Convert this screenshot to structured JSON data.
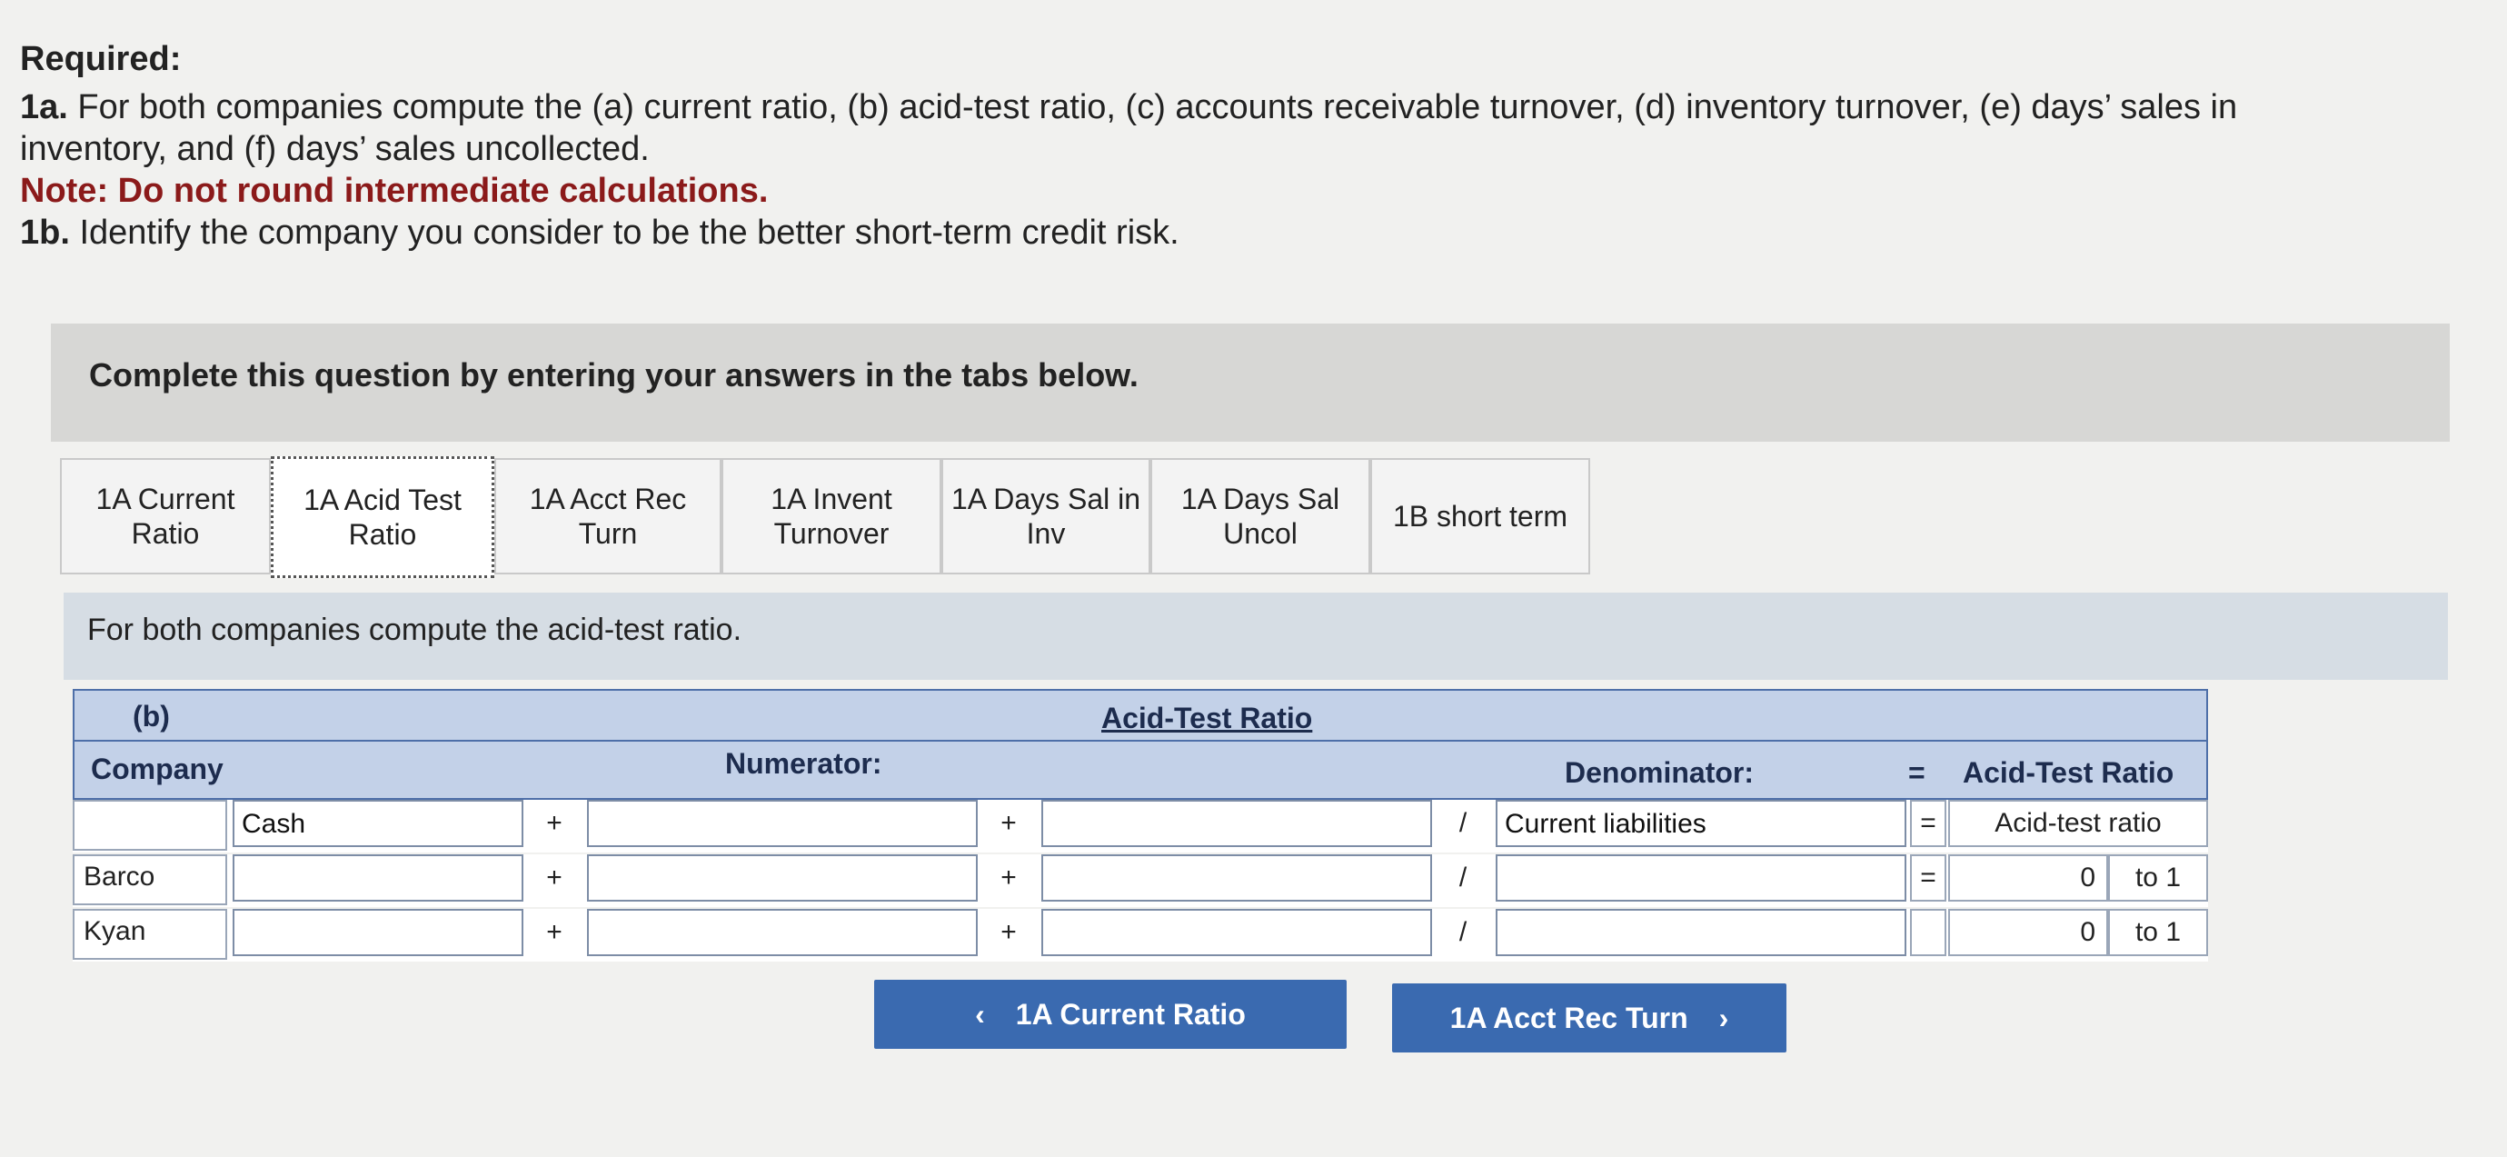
{
  "required": {
    "title": "Required:",
    "line1a_prefix": "1a.",
    "line1a_text": "For both companies compute the (a) current ratio, (b) acid-test ratio, (c) accounts receivable turnover, (d) inventory turnover, (e) days’ sales in inventory, and (f) days’ sales uncollected.",
    "note": "Note: Do not round intermediate calculations.",
    "line1b_prefix": "1b.",
    "line1b_text": "Identify the company you consider to be the better short-term credit risk."
  },
  "band": {
    "text": "Complete this question by entering your answers in the tabs below."
  },
  "tabs": [
    {
      "label": "1A Current\nRatio"
    },
    {
      "label": "1A Acid Test\nRatio"
    },
    {
      "label": "1A Acct Rec\nTurn"
    },
    {
      "label": "1A Invent\nTurnover"
    },
    {
      "label": "1A Days Sal in\nInv"
    },
    {
      "label": "1A Days Sal\nUncol"
    },
    {
      "label": "1B short term"
    }
  ],
  "instruction": "For both companies compute the acid-test ratio.",
  "table": {
    "part": "(b)",
    "title": "Acid-Test Ratio",
    "company_header": "Company",
    "numerator_header": "Numerator:",
    "denominator_header": "Denominator:",
    "equals": "=",
    "result_header": "Acid-Test Ratio",
    "label_row": {
      "num1": "Cash",
      "plus1": "+",
      "num2": "",
      "plus2": "+",
      "num3": "",
      "slash": "/",
      "den": "Current liabilities",
      "equals": "=",
      "result": "Acid-test ratio"
    },
    "rows": [
      {
        "company": "Barco",
        "plus1": "+",
        "plus2": "+",
        "slash": "/",
        "equals": "=",
        "value": "0",
        "suffix": "to 1"
      },
      {
        "company": "Kyan",
        "plus1": "+",
        "plus2": "+",
        "slash": "/",
        "equals": "",
        "value": "0",
        "suffix": "to 1"
      }
    ]
  },
  "nav": {
    "prev_label": "1A Current Ratio",
    "prev_icon": "‹",
    "next_label": "1A Acct Rec Turn",
    "next_icon": "›"
  }
}
